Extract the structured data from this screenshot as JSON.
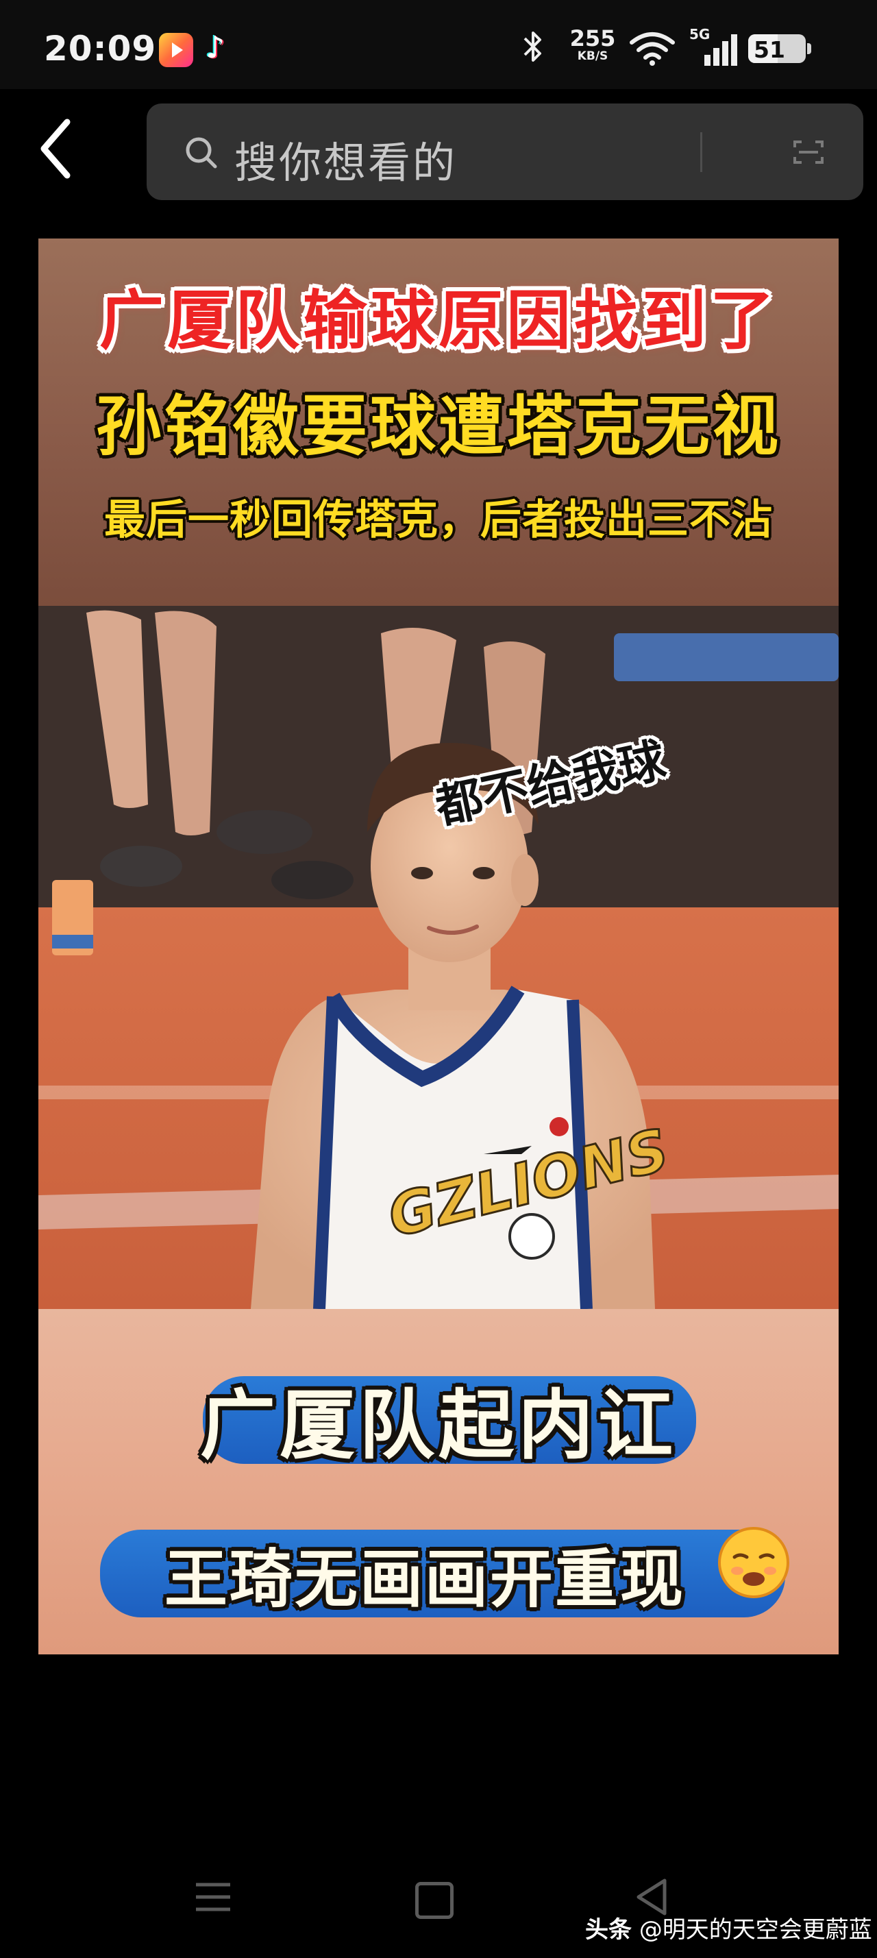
{
  "status_bar": {
    "time": "20:09",
    "net_speed_value": "255",
    "net_speed_unit": "KB/S",
    "signal_label": "5G",
    "battery_level": "51"
  },
  "search": {
    "placeholder": "搜你想看的"
  },
  "post": {
    "headline_1": "广厦队输球原因找到了",
    "headline_2": "孙铭徽要球遭塔克无视",
    "headline_3": "最后一秒回传塔克，后者投出三不沾",
    "speech_bubble": "都不给我球",
    "jersey_text": "GZLIONS",
    "banner_1": "广厦队起内讧",
    "banner_2": "王琦无画画开重现"
  },
  "watermark": {
    "brand": "头条",
    "handle": "@明天的天空会更蔚蓝"
  },
  "colors": {
    "headline_red": "#ee2424",
    "headline_yellow": "#ffdc23",
    "banner_blue": "#2a7bd7"
  }
}
